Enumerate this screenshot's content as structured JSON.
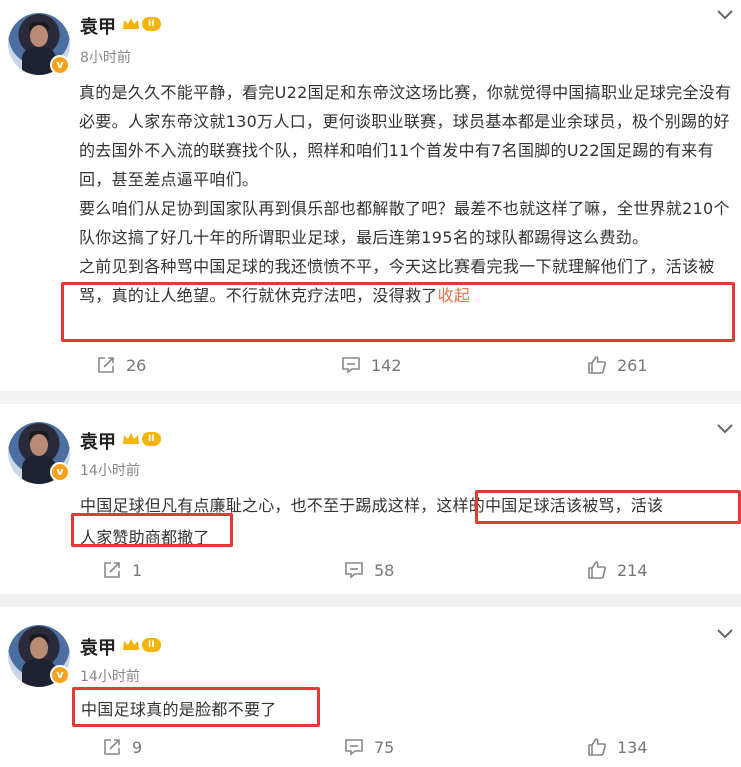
{
  "posts": [
    {
      "author": "袁甲",
      "level": "II",
      "verified_badge": "v",
      "time": "8小时前",
      "paragraphs": [
        "真的是久久不能平静，看完U22国足和东帝汶这场比赛，你就觉得中国搞职业足球完全没有必要。人家东帝汶就130万人口，更何谈职业联赛，球员基本都是业余球员，极个别踢的好的去国外不入流的联赛找个队，照样和咱们11个首发中有7名国脚的U22国足踢的有来有回，甚至差点逼平咱们。",
        "要么咱们从足协到国家队再到俱乐部也都解散了吧？最差不也就这样了嘛，全世界就210个队你这搞了好几十年的所谓职业足球，最后连第195名的球队都踢得这么费劲。",
        "之前见到各种骂中国足球的我还愤愤不平，今天这比赛看完我一下就理解他们了，活该被骂，真的让人绝望。不行就休克疗法吧，没得救了"
      ],
      "collapse_label": "收起",
      "reposts": "26",
      "comments": "142",
      "likes": "261"
    },
    {
      "author": "袁甲",
      "level": "II",
      "verified_badge": "v",
      "time": "14小时前",
      "text_part1": "中国足球但凡有点廉耻之心，也不至于踢成这样，",
      "text_part2": "这样的中国足球活该被骂，活该",
      "text_part3": "人家赞助商都撤了",
      "reposts": "1",
      "comments": "58",
      "likes": "214"
    },
    {
      "author": "袁甲",
      "level": "II",
      "verified_badge": "v",
      "time": "14小时前",
      "text": "中国足球真的是脸都不要了",
      "reposts": "9",
      "comments": "75",
      "likes": "134"
    }
  ],
  "colors": {
    "highlight_box": "#e53935",
    "collapse_link": "#eb7350",
    "level_pill": "#f5b400",
    "verified_badge": "#f7a21b"
  },
  "icons": [
    "chevron-down-icon",
    "repost-icon",
    "comment-icon",
    "like-icon",
    "crown-icon"
  ]
}
